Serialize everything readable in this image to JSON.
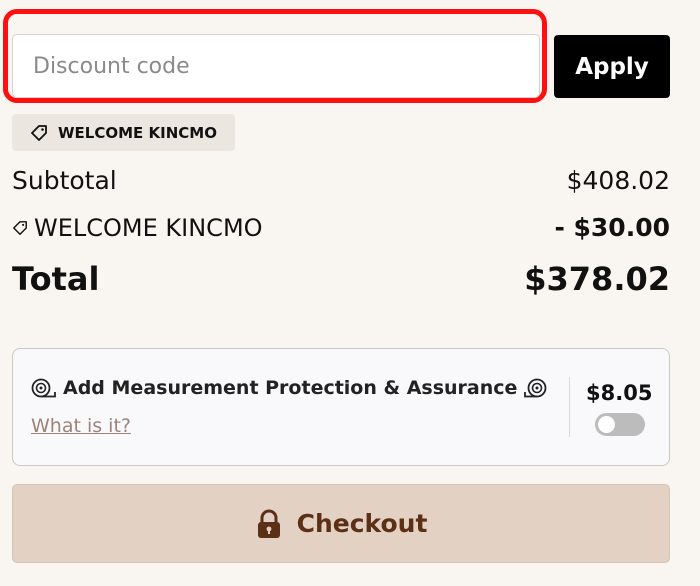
{
  "discount": {
    "placeholder": "Discount code",
    "apply_label": "Apply",
    "applied_code": "WELCOME KINCMO",
    "applied_icon": "tag-icon"
  },
  "totals": {
    "subtotal_label": "Subtotal",
    "subtotal_value": "$408.02",
    "discount_label": "WELCOME KINCMO",
    "discount_value": "- $30.00",
    "total_label": "Total",
    "total_value": "$378.02"
  },
  "protection": {
    "title": "Add Measurement Protection & Assurance",
    "link_label": "What is it?",
    "price": "$8.05",
    "enabled": false,
    "icon": "measuring-tape-icon"
  },
  "checkout": {
    "label": "Checkout",
    "icon": "lock-icon",
    "color": "#5c3016",
    "background": "#e3d1c3"
  },
  "colors": {
    "highlight": "#ff1010",
    "apply_bg": "#000000",
    "link": "#9e8478"
  }
}
